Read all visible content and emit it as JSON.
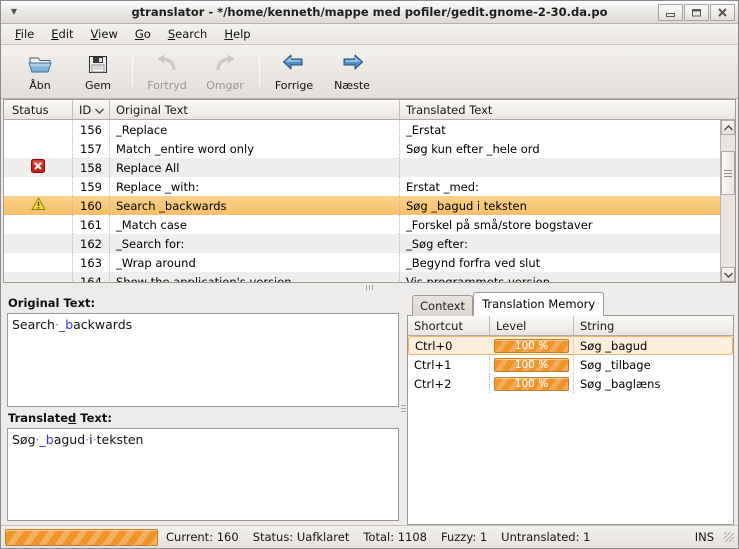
{
  "window": {
    "title": "gtranslator - */home/kenneth/mappe med pofiler/gedit.gnome-2-30.da.po",
    "menu_arrow_icon": "caret-down-icon",
    "buttons": [
      {
        "name": "minimize-button",
        "icon": "minimize-icon"
      },
      {
        "name": "maximize-button",
        "icon": "maximize-icon"
      },
      {
        "name": "close-button",
        "icon": "close-icon"
      }
    ]
  },
  "menubar": {
    "items": [
      {
        "label": "File",
        "mnemonic": "F"
      },
      {
        "label": "Edit",
        "mnemonic": "E"
      },
      {
        "label": "View",
        "mnemonic": "V"
      },
      {
        "label": "Go",
        "mnemonic": "G"
      },
      {
        "label": "Search",
        "mnemonic": "S"
      },
      {
        "label": "Help",
        "mnemonic": "H"
      }
    ]
  },
  "toolbar": {
    "buttons": [
      {
        "label": "Åbn",
        "icon": "open-folder-icon",
        "enabled": true
      },
      {
        "label": "Gem",
        "icon": "save-floppy-icon",
        "enabled": true
      },
      {
        "label": "Fortryd",
        "icon": "undo-arrow-icon",
        "enabled": false
      },
      {
        "label": "Omgør",
        "icon": "redo-arrow-icon",
        "enabled": false
      },
      {
        "label": "Forrige",
        "icon": "arrow-left-icon",
        "enabled": true
      },
      {
        "label": "Næste",
        "icon": "arrow-right-icon",
        "enabled": true
      }
    ]
  },
  "message_list": {
    "columns": [
      {
        "label": "Status",
        "sort_icon": ""
      },
      {
        "label": "ID",
        "sort_icon": "chevron-down-icon"
      },
      {
        "label": "Original Text",
        "sort_icon": ""
      },
      {
        "label": "Translated Text",
        "sort_icon": ""
      }
    ],
    "rows": [
      {
        "status": "",
        "id": "156",
        "original": "_Replace",
        "translated": "_Erstat",
        "selected": false
      },
      {
        "status": "",
        "id": "157",
        "original": "Match _entire word only",
        "translated": "Søg kun efter _hele ord",
        "selected": false
      },
      {
        "status": "error",
        "id": "158",
        "original": "Replace All",
        "translated": "",
        "selected": false
      },
      {
        "status": "",
        "id": "159",
        "original": "Replace _with:",
        "translated": "Erstat _med:",
        "selected": false
      },
      {
        "status": "warning",
        "id": "160",
        "original": "Search _backwards",
        "translated": "Søg _bagud i teksten",
        "selected": true
      },
      {
        "status": "",
        "id": "161",
        "original": "_Match case",
        "translated": "_Forskel på små/store bogstaver",
        "selected": false
      },
      {
        "status": "",
        "id": "162",
        "original": "_Search for:",
        "translated": "_Søg efter:",
        "selected": false
      },
      {
        "status": "",
        "id": "163",
        "original": "_Wrap around",
        "translated": "_Begynd forfra ved slut",
        "selected": false
      },
      {
        "status": "",
        "id": "164",
        "original": "Show the application's version",
        "translated": "Vis programmets version",
        "selected": false
      }
    ],
    "scrollbar": {
      "up_icon": "scroll-up-icon",
      "down_icon": "scroll-down-icon"
    }
  },
  "editor": {
    "original_label": "Original Text:",
    "original_mnemonic": "",
    "original_value": "Search._backwards",
    "translated_label": "Translated Text:",
    "translated_mnemonic": "d",
    "translated_value": "Søg._bagud.i.teksten"
  },
  "right_panel": {
    "tabs": [
      {
        "label": "Context",
        "active": false
      },
      {
        "label": "Translation Memory",
        "active": true
      }
    ],
    "tm_columns": [
      "Shortcut",
      "Level",
      "String"
    ],
    "tm_rows": [
      {
        "shortcut": "Ctrl+0",
        "level": "100 %",
        "string": "Søg _bagud",
        "selected": true
      },
      {
        "shortcut": "Ctrl+1",
        "level": "100 %",
        "string": "Søg _tilbage",
        "selected": false
      },
      {
        "shortcut": "Ctrl+2",
        "level": "100 %",
        "string": "Søg _baglæns",
        "selected": false
      }
    ]
  },
  "statusbar": {
    "progress_percent": 100,
    "current": "Current: 160",
    "status": "Status: Uafklaret",
    "total": "Total: 1108",
    "fuzzy": "Fuzzy: 1",
    "untranslated": "Untranslated: 1",
    "insert_mode": "INS"
  },
  "colors": {
    "accent_orange": "#f0942a",
    "selection_row": "#f6c87a",
    "tm_selection": "#fdeedb",
    "chrome": "#edeceb",
    "error_red": "#cc2222",
    "warning_yellow": "#e8c41d"
  }
}
